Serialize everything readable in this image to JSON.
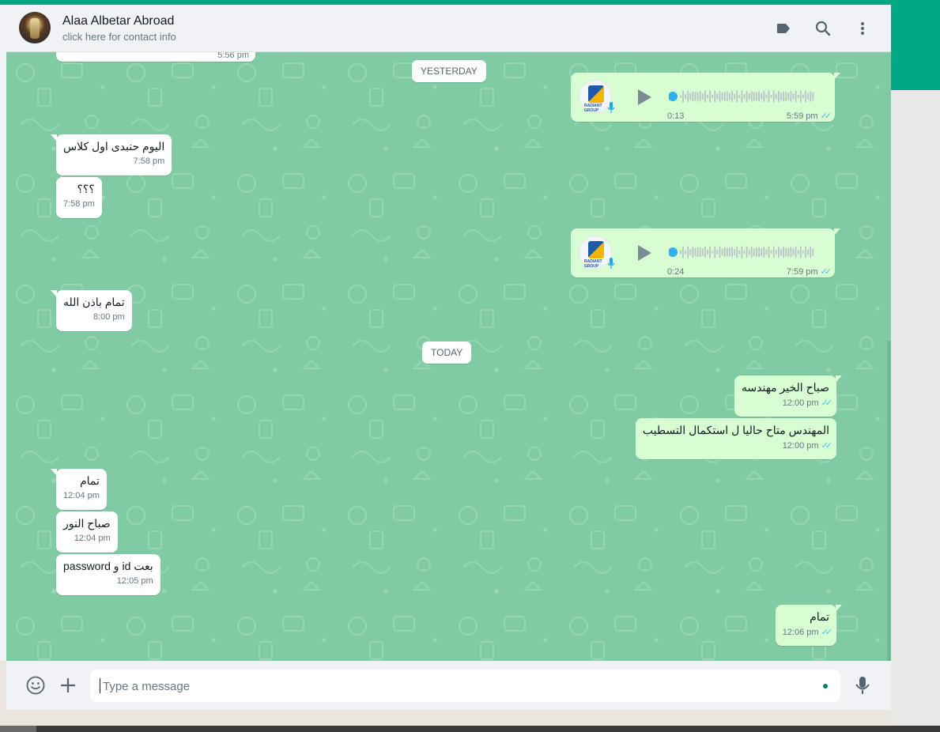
{
  "header": {
    "contact_name": "Alaa Albetar Abroad",
    "contact_sub": "click here for contact info",
    "icons": [
      "label-icon",
      "search-icon",
      "menu-icon"
    ]
  },
  "colors": {
    "accent": "#00a884",
    "chat_bg": "#80cba4",
    "incoming": "#ffffff",
    "outgoing": "#d9fdd3",
    "tick": "#53bdeb"
  },
  "chat": {
    "dates": {
      "yesterday": "YESTERDAY",
      "today": "TODAY"
    },
    "top_partial_time": "5:56 pm",
    "voice1": {
      "duration": "0:13",
      "time": "5:59 pm",
      "progress": 0,
      "logo_text": "RADIANT GROUP"
    },
    "voice2": {
      "duration": "0:24",
      "time": "7:59 pm",
      "progress": 0,
      "logo_text": "RADIANT GROUP"
    },
    "m1": {
      "text": "اليوم حنبدى اول كلاس",
      "time": "7:58 pm"
    },
    "m2": {
      "text": "؟؟؟",
      "time": "7:58 pm"
    },
    "m3": {
      "text": "تمام باذن الله",
      "time": "8:00 pm"
    },
    "m4": {
      "text": "صباح الخير مهندسه",
      "time": "12:00 pm"
    },
    "m5": {
      "text": "المهندس متاح حاليا ل استكمال التسطيب",
      "time": "12:00 pm"
    },
    "m6": {
      "text": "تمام",
      "time": "12:04 pm"
    },
    "m7": {
      "text": "صباح النور",
      "time": "12:04 pm"
    },
    "m8": {
      "text": "بعت id و password",
      "time": "12:05 pm"
    },
    "m9": {
      "text": "تمام",
      "time": "12:06 pm"
    },
    "read_tick": "✓✓"
  },
  "composer": {
    "placeholder": "Type a message",
    "icons": [
      "emoji-icon",
      "attach-plus-icon",
      "microphone-icon"
    ]
  }
}
